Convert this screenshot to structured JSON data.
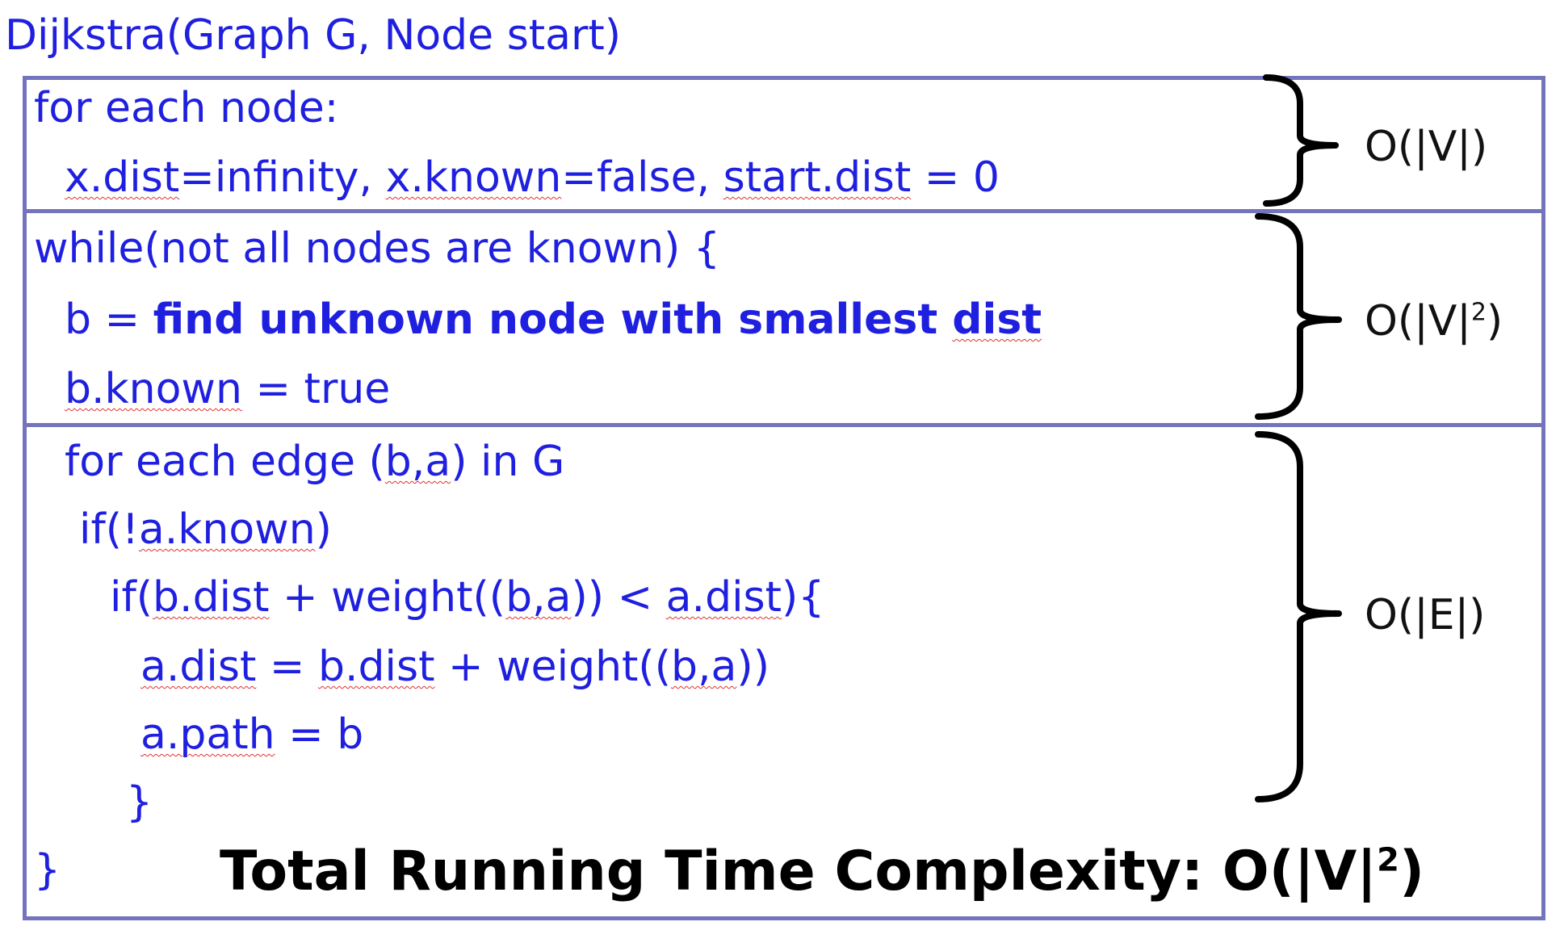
{
  "signature": "Dijkstra(Graph G, Node start)",
  "sections": {
    "init": {
      "line1": "for each node:",
      "line2": {
        "t1": "x.dist",
        "t2": "=infinity, ",
        "t3": "x.known",
        "t4": "=false, ",
        "t5": "start.dist",
        "t6": " = 0"
      },
      "complexity": {
        "base": "O(|V|)"
      }
    },
    "loop": {
      "line1": "while(not all nodes are known) {",
      "line2": {
        "t1": "b = ",
        "t2": "find unknown node with smallest ",
        "t3": "dist"
      },
      "line3": {
        "t1": "b.known",
        "t2": " = true"
      },
      "complexity": {
        "base": "O(|V|",
        "sup": "2",
        "close": ")"
      }
    },
    "edges": {
      "line1": {
        "t1": "for each edge (",
        "t2": "b,a",
        "t3": ") in G"
      },
      "line2": {
        "t1": "if(!",
        "t2": "a.known",
        "t3": ")"
      },
      "line3": {
        "t1": "if(",
        "t2": "b.dist",
        "t3": " + weight((",
        "t4": "b,a",
        "t5": ")) < ",
        "t6": "a.dist",
        "t7": "){"
      },
      "line4": {
        "t1": "a.dist",
        "t2": " = ",
        "t3": "b.dist",
        "t4": " + weight((",
        "t5": "b,a",
        "t6": "))"
      },
      "line5": {
        "t1": "a.path",
        "t2": " = b"
      },
      "line6": "}",
      "complexity": {
        "base": "O(|E|)"
      }
    },
    "closing_brace": "}"
  },
  "total": {
    "label": "Total Running Time Complexity: O(|V|",
    "sup": "2",
    "close": ")"
  },
  "colors": {
    "code": "#1f1fe0",
    "border": "#7474bd",
    "brace": "#000000",
    "spellcheck": "#e03030"
  }
}
